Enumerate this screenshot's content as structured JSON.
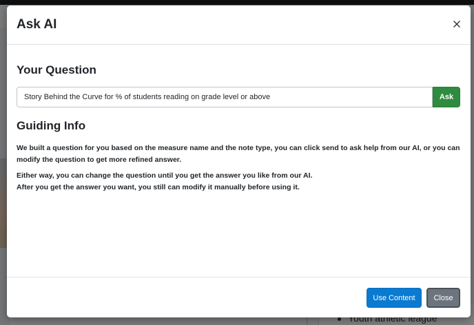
{
  "background": {
    "list_item": "Youth athletic league"
  },
  "modal": {
    "title": "Ask AI",
    "question_section": {
      "heading": "Your Question",
      "input_value": "Story Behind the Curve for % of students reading on grade level or above",
      "ask_label": "Ask"
    },
    "guiding_section": {
      "heading": "Guiding Info",
      "paragraph_1": "We built a question for you based on the measure name and the note type, you can click send to ask help from our AI, or you can modify the question to get more refined answer.",
      "paragraph_2_line_1": "Either way, you can change the question until you get the answer you like from our AI.",
      "paragraph_2_line_2": "After you get the answer you want, you still can modify it manually before using it."
    },
    "footer": {
      "use_content_label": "Use Content",
      "close_label": "Close"
    }
  },
  "colors": {
    "ask_button": "#2e8b3f",
    "use_content_button": "#0b7ad1",
    "close_button": "#6c757d",
    "backdrop": "rgba(0,0,0,0.5)"
  },
  "icons": {
    "close": "close-icon"
  }
}
